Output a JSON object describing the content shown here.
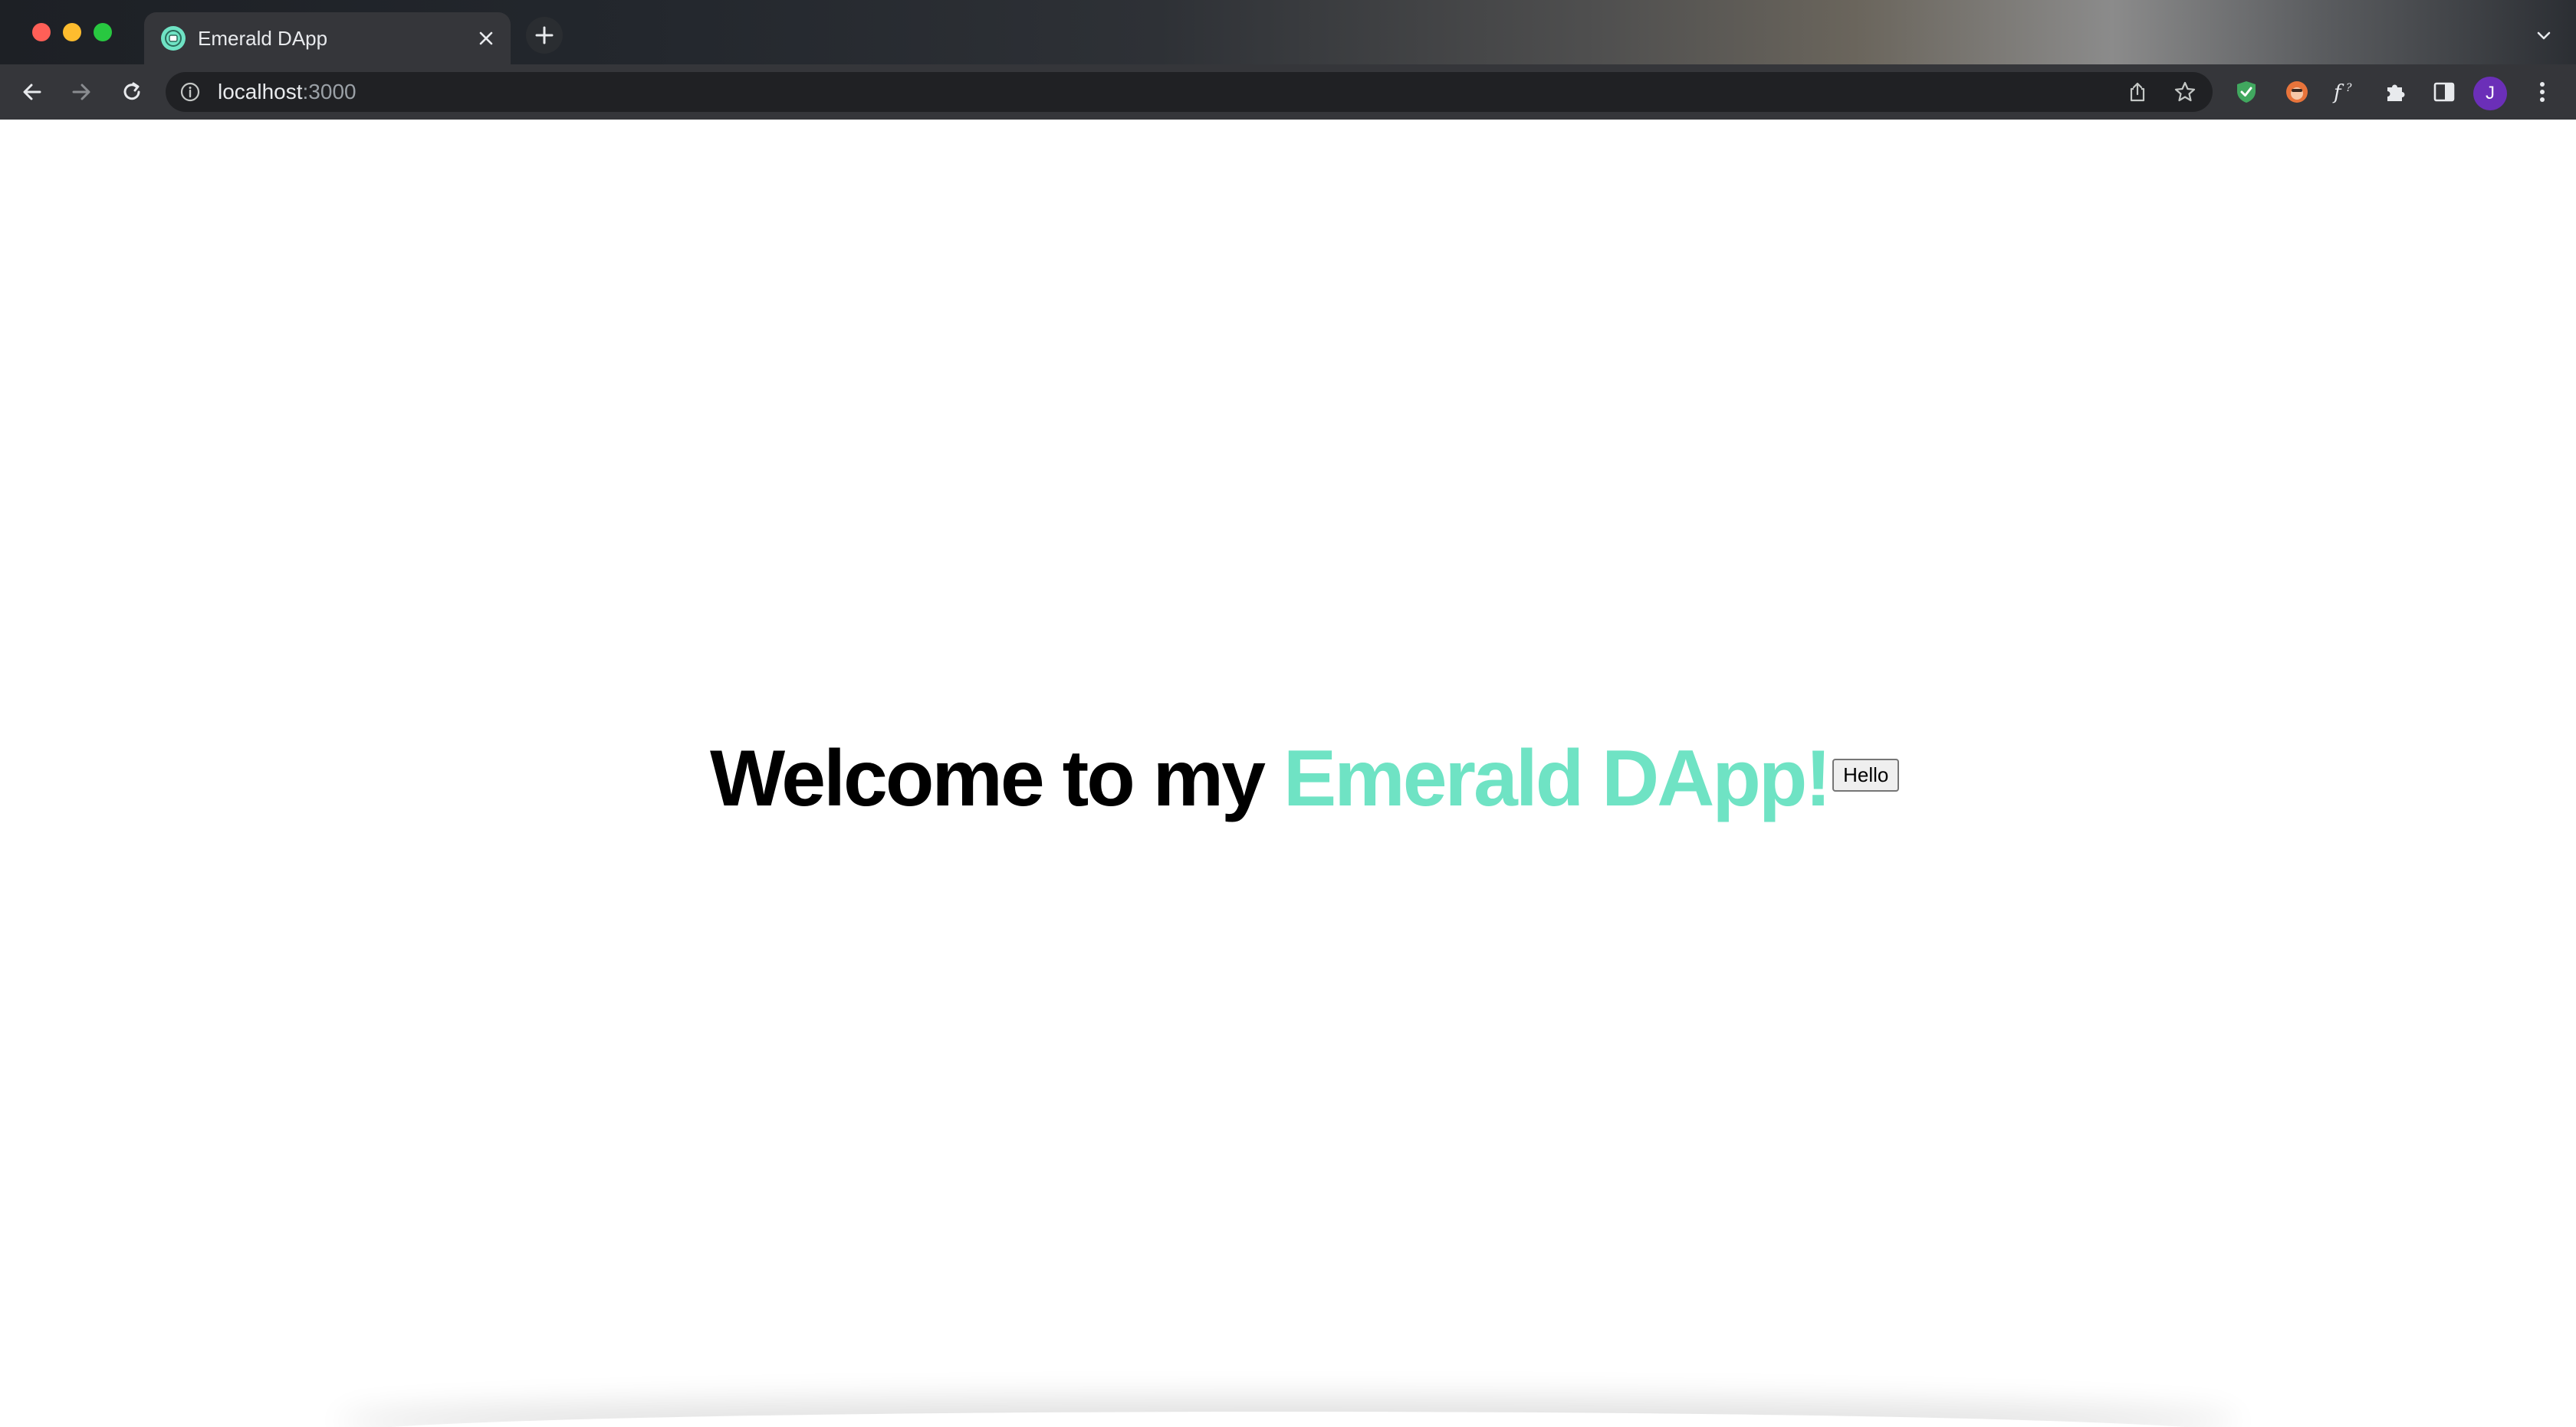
{
  "browser": {
    "tab": {
      "title": "Emerald DApp"
    },
    "address_bar": {
      "host": "localhost",
      "port": ":3000"
    },
    "profile": {
      "initial": "J",
      "color": "#6b2fb8"
    },
    "icons": {
      "back": "arrow-left-icon",
      "forward": "arrow-right-icon",
      "reload": "reload-icon",
      "site_info": "info-icon",
      "share": "share-icon",
      "bookmark": "star-icon",
      "extensions": [
        "shield-extension-icon",
        "fox-extension-icon",
        "font-extension-icon",
        "puzzle-icon",
        "side-panel-icon"
      ],
      "menu": "kebab-menu-icon"
    }
  },
  "page": {
    "heading_prefix": "Welcome to my ",
    "heading_accent": "Emerald DApp!",
    "button_label": "Hello",
    "accent_color": "#6fe3c4"
  }
}
